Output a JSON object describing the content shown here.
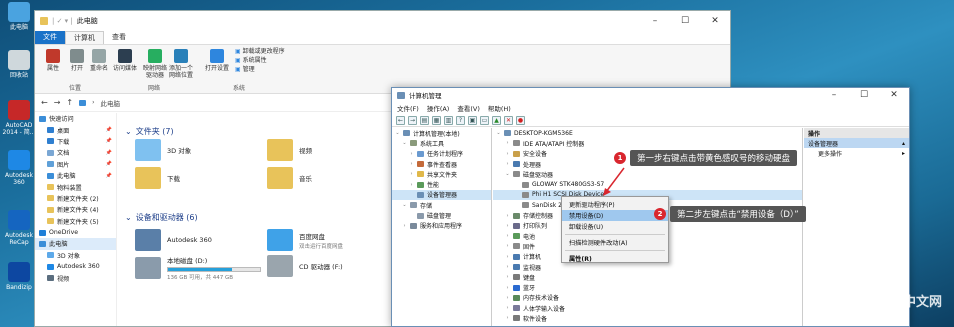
{
  "desktop": {
    "icons": [
      {
        "label": "此电脑",
        "icon": "computer-icon",
        "color": "#4aa3e0"
      },
      {
        "label": "回收站",
        "icon": "recycle-bin-icon",
        "color": "#cfd8dc"
      },
      {
        "label": "AutoCAD 2014 - 简...",
        "icon": "autocad-icon",
        "color": "#c62828"
      },
      {
        "label": "Autodesk 360",
        "icon": "autodesk-360-icon",
        "color": "#1e88e5"
      },
      {
        "label": "Autodesk ReCap",
        "icon": "recap-icon",
        "color": "#1565c0"
      },
      {
        "label": "Bandizip",
        "icon": "bandizip-icon",
        "color": "#0d47a1"
      }
    ],
    "watermark": "php 中文网"
  },
  "explorer": {
    "title": "此电脑",
    "tabs": [
      "文件",
      "计算机",
      "查看"
    ],
    "ribbon_items": [
      {
        "label": "属性",
        "icon": "properties-icon",
        "color": "#c0392b"
      },
      {
        "label": "打开",
        "icon": "open-icon",
        "color": "#7f8c8d"
      },
      {
        "label": "重命名",
        "icon": "rename-icon",
        "color": "#95a5a6"
      },
      {
        "label": "访问媒体",
        "icon": "media-icon",
        "color": "#2c3e50"
      },
      {
        "label": "映射网络驱动器",
        "icon": "map-drive-icon",
        "color": "#27ae60"
      },
      {
        "label": "添加一个网络位置",
        "icon": "network-location-icon",
        "color": "#2980b9"
      },
      {
        "label": "打开设置",
        "icon": "settings-icon",
        "color": "#2e86de"
      }
    ],
    "ribbon_links": [
      "卸载或更改程序",
      "系统属性",
      "管理"
    ],
    "ribbon_groups": [
      "位置",
      "网络",
      "系统"
    ],
    "address": "此电脑",
    "nav": [
      {
        "label": "快速访问",
        "icon": "star-icon",
        "color": "#3b8ed8",
        "pin": false
      },
      {
        "label": "桌面",
        "icon": "desktop-icon",
        "color": "#2f7fd0",
        "pin": true
      },
      {
        "label": "下载",
        "icon": "download-icon",
        "color": "#2f7fd0",
        "pin": true
      },
      {
        "label": "文档",
        "icon": "document-icon",
        "color": "#7aa7d4",
        "pin": true
      },
      {
        "label": "图片",
        "icon": "picture-icon",
        "color": "#5fa0d8",
        "pin": true
      },
      {
        "label": "此电脑",
        "icon": "computer-icon",
        "color": "#3b8ed8",
        "pin": true
      },
      {
        "label": "物料装置",
        "icon": "folder-icon",
        "color": "#e8c35a",
        "pin": false
      },
      {
        "label": "新建文件夹 (2)",
        "icon": "folder-icon",
        "color": "#e8c35a",
        "pin": false
      },
      {
        "label": "新建文件夹 (4)",
        "icon": "folder-icon",
        "color": "#e8c35a",
        "pin": false
      },
      {
        "label": "新建文件夹 (5)",
        "icon": "folder-icon",
        "color": "#e8c35a",
        "pin": false
      },
      {
        "label": "OneDrive",
        "icon": "onedrive-icon",
        "color": "#1e7fd8",
        "pin": false
      },
      {
        "label": "此电脑",
        "icon": "computer-icon",
        "color": "#3b8ed8",
        "pin": false
      },
      {
        "label": "3D 对象",
        "icon": "3d-objects-icon",
        "color": "#5da9e9",
        "pin": false
      },
      {
        "label": "Autodesk 360",
        "icon": "autodesk-360-icon",
        "color": "#1e88e5",
        "pin": false
      },
      {
        "label": "视频",
        "icon": "video-icon",
        "color": "#5b6e7f",
        "pin": false
      }
    ],
    "folders_header": "文件夹 (7)",
    "folders": [
      {
        "label": "3D 对象",
        "icon": "3d-objects-icon",
        "color": "#7fc1f0"
      },
      {
        "label": "视频",
        "icon": "video-icon",
        "color": "#e8c35a"
      },
      {
        "label": "下载",
        "icon": "download-icon",
        "color": "#e8c35a"
      },
      {
        "label": "音乐",
        "icon": "music-icon",
        "color": "#e8c35a"
      }
    ],
    "drives_header": "设备和驱动器 (6)",
    "drives": [
      {
        "label": "Autodesk 360",
        "sub": "",
        "icon": "autodesk-360-icon",
        "color": "#5a7fa8"
      },
      {
        "label": "百度网盘",
        "sub": "双击运行百度网盘",
        "icon": "baidu-netdisk-icon",
        "color": "#3fa2e8"
      },
      {
        "label": "本地磁盘 (D:)",
        "sub": "136 GB 可用，共 447 GB",
        "icon": "local-disk-icon",
        "color": "#8a9bab",
        "used_fraction": 0.7
      },
      {
        "label": "CD 驱动器 (F:)",
        "sub": "",
        "icon": "cd-drive-icon",
        "color": "#9aa5ad"
      }
    ]
  },
  "mgmt": {
    "title": "计算机管理",
    "menu": [
      "文件(F)",
      "操作(A)",
      "查看(V)",
      "帮助(H)"
    ],
    "left_tree": [
      {
        "label": "计算机管理(本地)",
        "level": 0,
        "expander": "v",
        "color": "#6a8fb5"
      },
      {
        "label": "系统工具",
        "level": 1,
        "expander": "v",
        "color": "#8a9a7b"
      },
      {
        "label": "任务计划程序",
        "level": 2,
        "expander": ">",
        "color": "#6a9ad0"
      },
      {
        "label": "事件查看器",
        "level": 2,
        "expander": ">",
        "color": "#c46a3a"
      },
      {
        "label": "共享文件夹",
        "level": 2,
        "expander": ">",
        "color": "#e0b84a"
      },
      {
        "label": "性能",
        "level": 2,
        "expander": ">",
        "color": "#5a9a5a"
      },
      {
        "label": "设备管理器",
        "level": 2,
        "expander": "",
        "color": "#6a8fb5",
        "selected": true
      },
      {
        "label": "存储",
        "level": 1,
        "expander": "v",
        "color": "#8a9aab"
      },
      {
        "label": "磁盘管理",
        "level": 2,
        "expander": "",
        "color": "#8a9aab"
      },
      {
        "label": "服务和应用程序",
        "level": 1,
        "expander": ">",
        "color": "#7a8a9b"
      }
    ],
    "device_tree": [
      {
        "label": "DESKTOP-KGM536E",
        "level": 0,
        "expander": "v",
        "color": "#6a8fb5"
      },
      {
        "label": "IDE ATA/ATAPI 控制器",
        "level": 1,
        "expander": ">",
        "color": "#8a8a8a"
      },
      {
        "label": "安全设备",
        "level": 1,
        "expander": ">",
        "color": "#c9a04a"
      },
      {
        "label": "处理器",
        "level": 1,
        "expander": ">",
        "color": "#4a7ab0"
      },
      {
        "label": "磁盘驱动器",
        "level": 1,
        "expander": "v",
        "color": "#8a8a8a"
      },
      {
        "label": "GLOWAY STK480GS3-S7",
        "level": 2,
        "expander": "",
        "color": "#8a8a8a"
      },
      {
        "label": "Phi H1 SCSI Disk Device",
        "level": 2,
        "expander": "",
        "color": "#8a8a8a",
        "selected": true
      },
      {
        "label": "SanDisk 2...",
        "level": 2,
        "expander": "",
        "color": "#8a8a8a"
      },
      {
        "label": "存储控制器",
        "level": 1,
        "expander": ">",
        "color": "#6a8a6a"
      },
      {
        "label": "打印队列",
        "level": 1,
        "expander": ">",
        "color": "#6a6a8a"
      },
      {
        "label": "电池",
        "level": 1,
        "expander": ">",
        "color": "#5a9a5a"
      },
      {
        "label": "固件",
        "level": 1,
        "expander": ">",
        "color": "#8a8a8a"
      },
      {
        "label": "计算机",
        "level": 1,
        "expander": ">",
        "color": "#4a7ab0"
      },
      {
        "label": "监视器",
        "level": 1,
        "expander": ">",
        "color": "#4a7ab0"
      },
      {
        "label": "键盘",
        "level": 1,
        "expander": ">",
        "color": "#7a7a7a"
      },
      {
        "label": "蓝牙",
        "level": 1,
        "expander": ">",
        "color": "#2a6ad0"
      },
      {
        "label": "内存技术设备",
        "level": 1,
        "expander": ">",
        "color": "#5a8a5a"
      },
      {
        "label": "人体学输入设备",
        "level": 1,
        "expander": ">",
        "color": "#7a7a9a"
      },
      {
        "label": "软件设备",
        "level": 1,
        "expander": ">",
        "color": "#7a7a7a"
      }
    ],
    "actions": {
      "header": "操作",
      "sub": "设备管理器",
      "more": "更多操作"
    },
    "context_menu": [
      {
        "label": "更新驱动程序(P)",
        "highlight": false
      },
      {
        "label": "禁用设备(D)",
        "highlight": true
      },
      {
        "label": "卸载设备(U)",
        "highlight": false
      },
      {
        "sep": true
      },
      {
        "label": "扫描检测硬件改动(A)",
        "highlight": false
      },
      {
        "sep": true
      },
      {
        "label": "属性(R)",
        "highlight": false,
        "bold": true
      }
    ]
  },
  "callouts": [
    {
      "step": "1",
      "text": "第一步右键点击带黄色感叹号的移动硬盘"
    },
    {
      "step": "2",
      "text": "第二步左键点击“禁用设备（D）”"
    }
  ]
}
